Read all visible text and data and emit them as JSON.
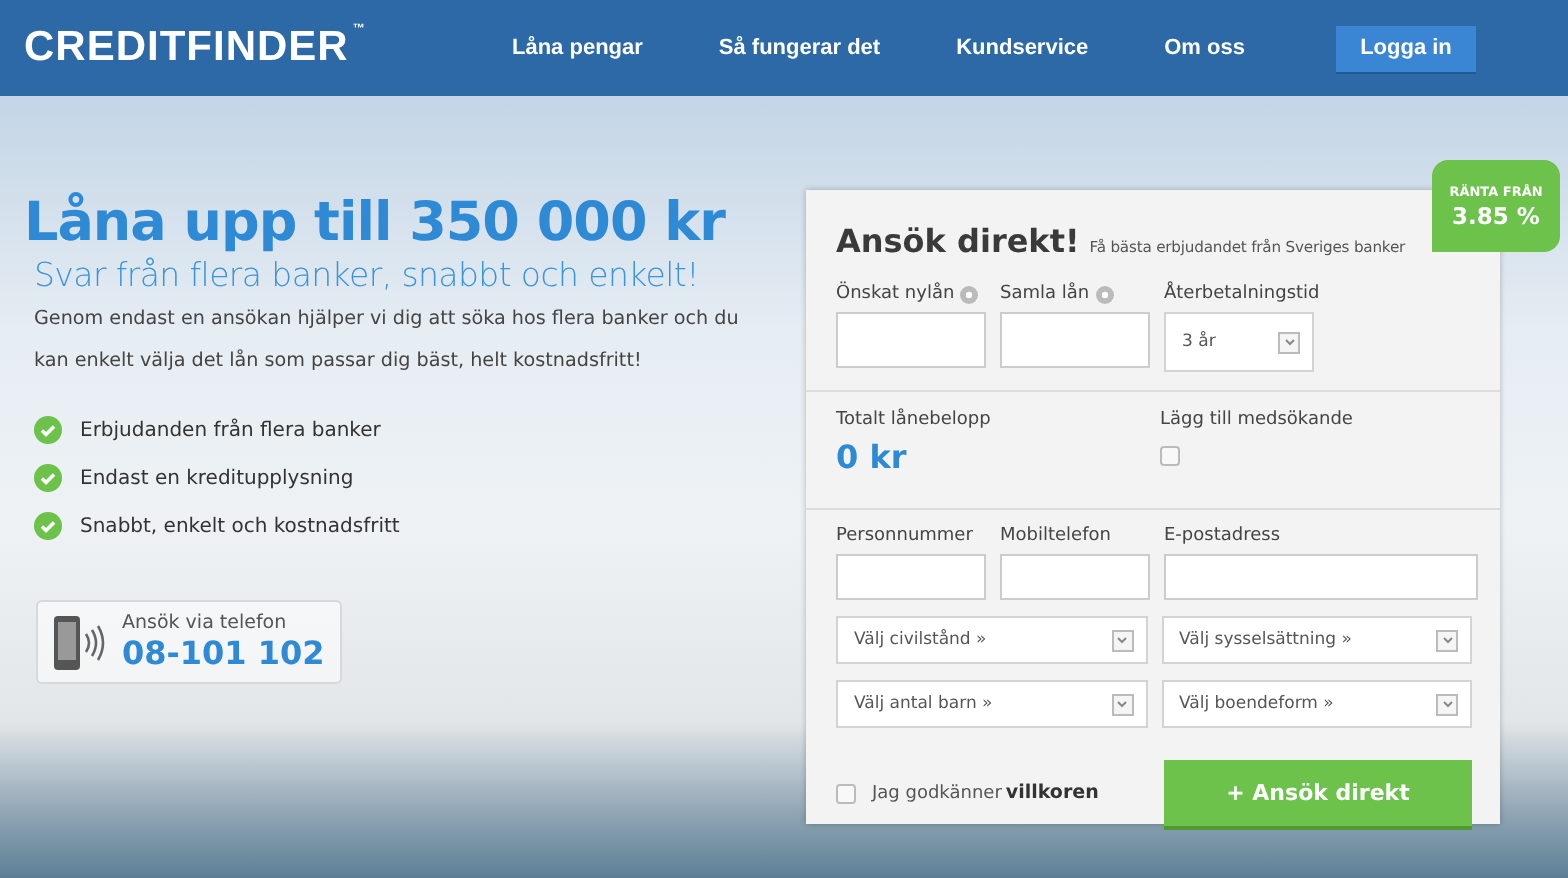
{
  "header": {
    "logo": "CREDITFINDER",
    "trademark": "™",
    "nav": [
      {
        "label": "Låna pengar"
      },
      {
        "label": "Så fungerar det"
      },
      {
        "label": "Kundservice"
      },
      {
        "label": "Om oss"
      }
    ],
    "login_button": "Logga in"
  },
  "hero": {
    "title": "Låna upp till 350 000 kr",
    "subtitle": "Svar från flera banker, snabbt och enkelt!",
    "description": "Genom endast en ansökan hjälper vi dig att söka hos flera banker och du kan enkelt välja det lån som passar dig bäst, helt kostnadsfritt!",
    "benefits": [
      "Erbjudanden från flera banker",
      "Endast en kreditupplysning",
      "Snabbt, enkelt och kostnadsfritt"
    ],
    "phone": {
      "label": "Ansök via telefon",
      "number": "08-101 102"
    }
  },
  "rate_badge": {
    "label": "RÄNTA FRÅN",
    "value": "3.85 %"
  },
  "form": {
    "title": "Ansök direkt!",
    "tagline": "Få bästa erbjudandet från Sveriges banker",
    "loan_fields": [
      {
        "label": "Önskat nylån",
        "kind": "text",
        "help": true
      },
      {
        "label": "Samla lån",
        "kind": "text",
        "help": true
      },
      {
        "label": "Återbetalningstid",
        "kind": "select",
        "value": "3 år"
      }
    ],
    "total": {
      "label": "Totalt lånebelopp",
      "value": "0 kr"
    },
    "co_applicant": {
      "label": "Lägg till medsökande",
      "checked": false
    },
    "contact_fields": [
      {
        "label": "Personnummer"
      },
      {
        "label": "Mobiltelefon"
      },
      {
        "label": "E-postadress"
      }
    ],
    "selects": [
      {
        "value": "Välj civilstånd »"
      },
      {
        "value": "Välj sysselsättning »"
      },
      {
        "value": "Välj antal barn »"
      },
      {
        "value": "Välj boendeform »"
      }
    ],
    "terms": {
      "text": "Jag godkänner",
      "link": "villkoren",
      "checked": false
    },
    "submit": "+ Ansök direkt"
  }
}
